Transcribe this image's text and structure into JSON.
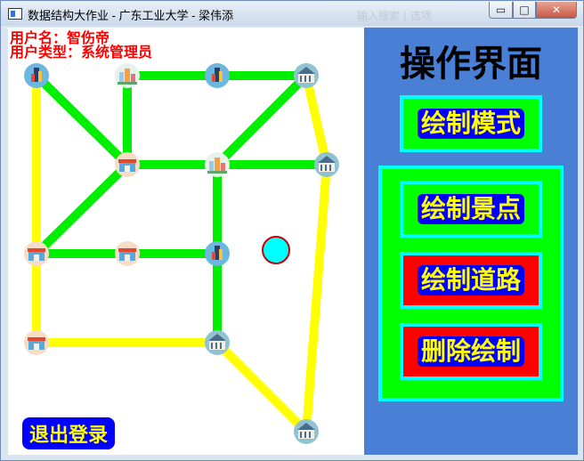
{
  "window": {
    "title": "数据结构大作业 - 广东工业大学 - 梁伟添",
    "minimize_symbol": "▭",
    "maximize_symbol": "□",
    "close_symbol": "✕",
    "ghost_text": "输入搜索 | 选项"
  },
  "canvas": {
    "user_name_line": "用户名：智伤帝",
    "user_type_line": "用户类型：系统管理员",
    "logout_label": "退出登录"
  },
  "panel": {
    "title": "操作界面",
    "draw_mode_label": "绘制模式",
    "draw_spot_label": "绘制景点",
    "draw_road_label": "绘制道路",
    "delete_label": "删除绘制"
  },
  "colors": {
    "green_road": "#00ee00",
    "yellow_road": "#ffff00",
    "cursor_fill": "#00ffff",
    "cursor_stroke": "#cc0000",
    "panel_bg": "#4a7fd6"
  },
  "spots": [
    {
      "id": "s1",
      "icon": "tower-icon"
    },
    {
      "id": "s2",
      "icon": "city-icon"
    },
    {
      "id": "s3",
      "icon": "tower-icon"
    },
    {
      "id": "s4",
      "icon": "building-icon"
    },
    {
      "id": "s5",
      "icon": "shop-icon"
    },
    {
      "id": "s6",
      "icon": "city-icon"
    },
    {
      "id": "s7",
      "icon": "building-icon"
    },
    {
      "id": "s8",
      "icon": "shop-icon"
    },
    {
      "id": "s9",
      "icon": "shop-icon"
    },
    {
      "id": "s10",
      "icon": "tower-icon"
    },
    {
      "id": "s11",
      "icon": "shop-icon"
    },
    {
      "id": "s12",
      "icon": "building-icon"
    },
    {
      "id": "s13",
      "icon": "building-icon"
    }
  ],
  "roads": [
    {
      "from": "s1",
      "to": "s5",
      "type": "green"
    },
    {
      "from": "s2",
      "to": "s3",
      "type": "green"
    },
    {
      "from": "s3",
      "to": "s4",
      "type": "green"
    },
    {
      "from": "s2",
      "to": "s5",
      "type": "green"
    },
    {
      "from": "s4",
      "to": "s6",
      "type": "green"
    },
    {
      "from": "s5",
      "to": "s6",
      "type": "green"
    },
    {
      "from": "s6",
      "to": "s7",
      "type": "green"
    },
    {
      "from": "s5",
      "to": "s8",
      "type": "green"
    },
    {
      "from": "s6",
      "to": "s10",
      "type": "green"
    },
    {
      "from": "s8",
      "to": "s9",
      "type": "green"
    },
    {
      "from": "s9",
      "to": "s10",
      "type": "green"
    },
    {
      "from": "s10",
      "to": "s12",
      "type": "green"
    },
    {
      "from": "s1",
      "to": "s8",
      "type": "yellow"
    },
    {
      "from": "s4",
      "to": "s7",
      "type": "yellow"
    },
    {
      "from": "s7",
      "to": "s13",
      "type": "yellow"
    },
    {
      "from": "s8",
      "to": "s11",
      "type": "yellow"
    },
    {
      "from": "s11",
      "to": "s12",
      "type": "yellow"
    },
    {
      "from": "s12",
      "to": "s13",
      "type": "yellow"
    }
  ]
}
